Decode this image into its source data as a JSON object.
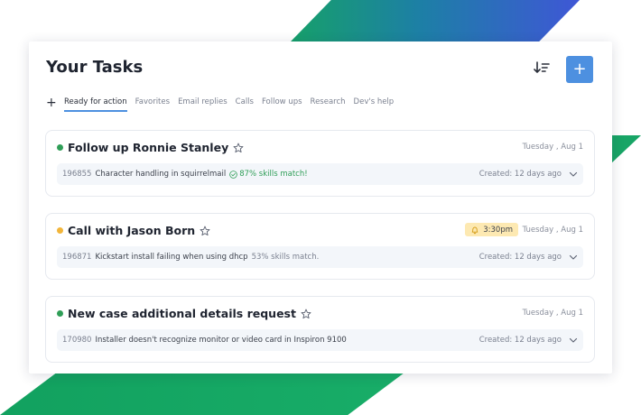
{
  "header": {
    "title": "Your Tasks",
    "add_label": "+",
    "sort_icon": "sort-descending-icon",
    "accent_color": "#4d90e0"
  },
  "tabs": {
    "add_label": "+",
    "items": [
      {
        "label": "Ready for action",
        "active": true
      },
      {
        "label": "Favorites"
      },
      {
        "label": "Email replies"
      },
      {
        "label": "Calls"
      },
      {
        "label": "Follow ups"
      },
      {
        "label": "Research"
      },
      {
        "label": "Dev's help"
      }
    ]
  },
  "tasks": [
    {
      "title": "Follow up Ronnie Stanley",
      "status_color": "#2f9e57",
      "date": "Tuesday , Aug 1",
      "case_id": "196855",
      "description": "Character handling in squirrelmail",
      "match": "87% skills match!",
      "created": "Created: 12 days ago"
    },
    {
      "title": "Call with Jason Born",
      "status_color": "#f2b53a",
      "reminder": "3:30pm",
      "date": "Tuesday , Aug 1",
      "case_id": "196871",
      "description": "Kickstart install failing when using dhcp",
      "match": "53% skills match.",
      "created": "Created: 12 days ago"
    },
    {
      "title": "New case additional details request",
      "status_color": "#2f9e57",
      "date": "Tuesday , Aug 1",
      "case_id": "170980",
      "description": "Installer doesn't recognize monitor or video card in Inspiron 9100",
      "created": "Created: 12 days ago"
    }
  ]
}
